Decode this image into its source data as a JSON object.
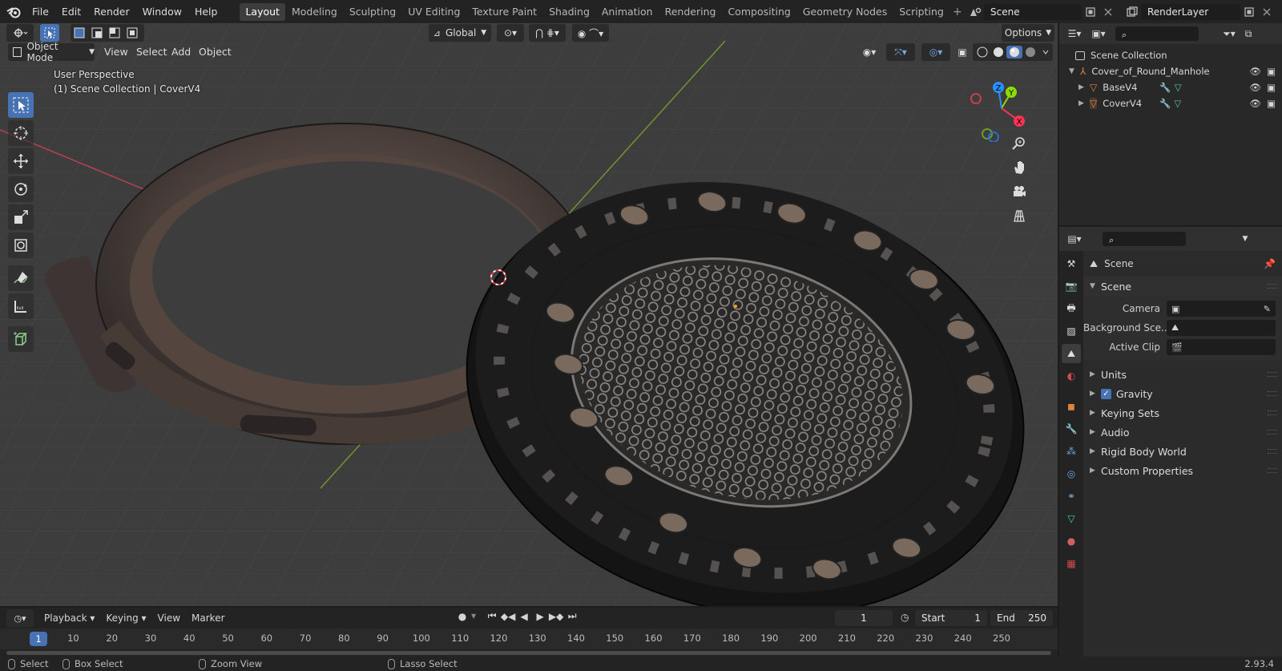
{
  "topbar": {
    "menus": [
      "File",
      "Edit",
      "Render",
      "Window",
      "Help"
    ],
    "workspaces": [
      "Layout",
      "Modeling",
      "Sculpting",
      "UV Editing",
      "Texture Paint",
      "Shading",
      "Animation",
      "Rendering",
      "Compositing",
      "Geometry Nodes",
      "Scripting"
    ],
    "active_workspace": "Layout",
    "scene": "Scene",
    "view_layer": "RenderLayer"
  },
  "viewport": {
    "mode": "Object Mode",
    "menus": [
      "View",
      "Select",
      "Add",
      "Object"
    ],
    "orientation": "Global",
    "options_label": "Options",
    "info_line1": "User Perspective",
    "info_line2": "(1) Scene Collection | CoverV4",
    "gizmo_axes": [
      "X",
      "Y",
      "Z"
    ],
    "tools": [
      "select-box-icon",
      "cursor-icon",
      "move-icon",
      "rotate-icon",
      "scale-icon",
      "transform-icon",
      "annotate-icon",
      "measure-icon",
      "add-cube-icon"
    ],
    "nav_buttons": [
      "zoom-icon",
      "hand-pan-icon",
      "camera-icon",
      "grid-ortho-icon"
    ]
  },
  "outliner": {
    "root": "Scene Collection",
    "items": [
      {
        "name": "Cover_of_Round_Manhole_Ol",
        "level": 1
      },
      {
        "name": "BaseV4",
        "level": 2
      },
      {
        "name": "CoverV4",
        "level": 2
      }
    ]
  },
  "properties": {
    "context_title": "Scene",
    "section_title": "Scene",
    "camera_label": "Camera",
    "background_scene_label": "Background Sce...",
    "active_clip_label": "Active Clip",
    "gravity_checked": true,
    "panels": [
      "Units",
      "Gravity",
      "Keying Sets",
      "Audio",
      "Rigid Body World",
      "Custom Properties"
    ]
  },
  "timeline": {
    "menus": [
      "Playback",
      "Keying",
      "View",
      "Marker"
    ],
    "current_frame": "1",
    "start_label": "Start",
    "start_value": "1",
    "end_label": "End",
    "end_value": "250",
    "ticks": [
      "1",
      "10",
      "20",
      "30",
      "40",
      "50",
      "60",
      "70",
      "80",
      "90",
      "100",
      "110",
      "120",
      "130",
      "140",
      "150",
      "160",
      "170",
      "180",
      "190",
      "200",
      "210",
      "220",
      "230",
      "240",
      "250"
    ]
  },
  "statusbar": {
    "select": "Select",
    "box_select": "Box Select",
    "zoom_view": "Zoom View",
    "lasso_select": "Lasso Select",
    "version": "2.93.4"
  },
  "colors": {
    "accent": "#4772b3",
    "x_axis": "#ff3352",
    "y_axis": "#8bdc00",
    "z_axis": "#2890ff",
    "object_orange": "#e0833b"
  }
}
